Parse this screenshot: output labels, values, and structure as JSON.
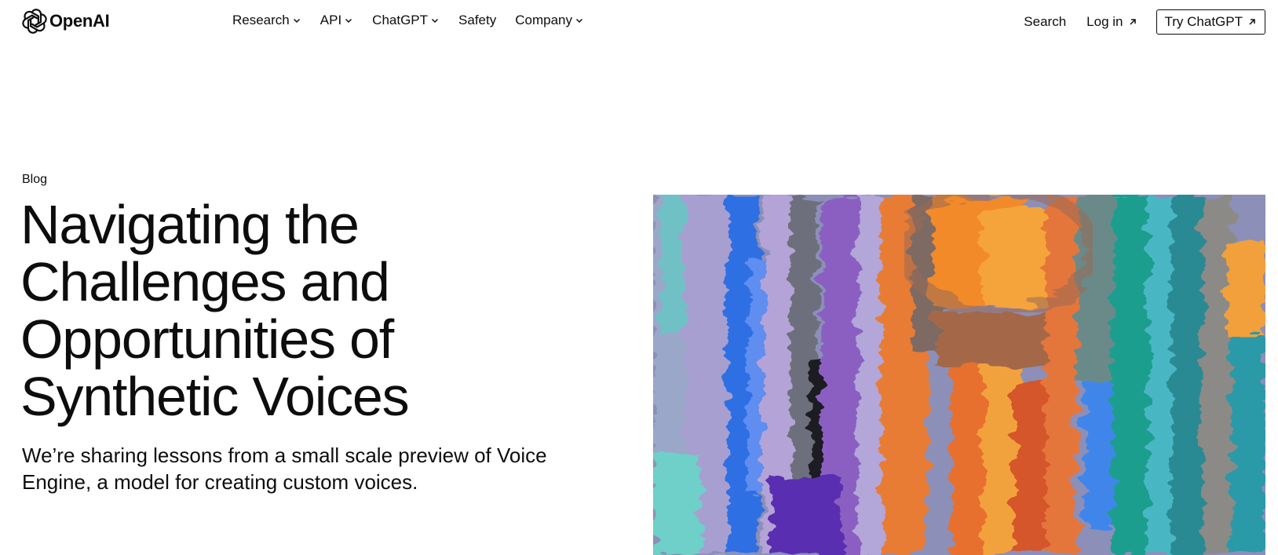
{
  "header": {
    "logo_text": "OpenAI",
    "nav": [
      {
        "label": "Research",
        "has_dropdown": true
      },
      {
        "label": "API",
        "has_dropdown": true
      },
      {
        "label": "ChatGPT",
        "has_dropdown": true
      },
      {
        "label": "Safety",
        "has_dropdown": false
      },
      {
        "label": "Company",
        "has_dropdown": true
      }
    ],
    "search_label": "Search",
    "login_label": "Log in",
    "try_label": "Try ChatGPT"
  },
  "hero": {
    "eyebrow": "Blog",
    "title": "Navigating the Challenges and Opportunities of Synthetic Voices",
    "subtitle": "We’re sharing lessons from a small scale preview of Voice Engine, a model for creating custom voices."
  },
  "icons": {
    "logo": "openai-logo-icon",
    "dropdown": "chevron-down-icon",
    "external": "arrow-up-right-icon"
  },
  "colors": {
    "text": "#0d0d0d",
    "background": "#ffffff"
  }
}
